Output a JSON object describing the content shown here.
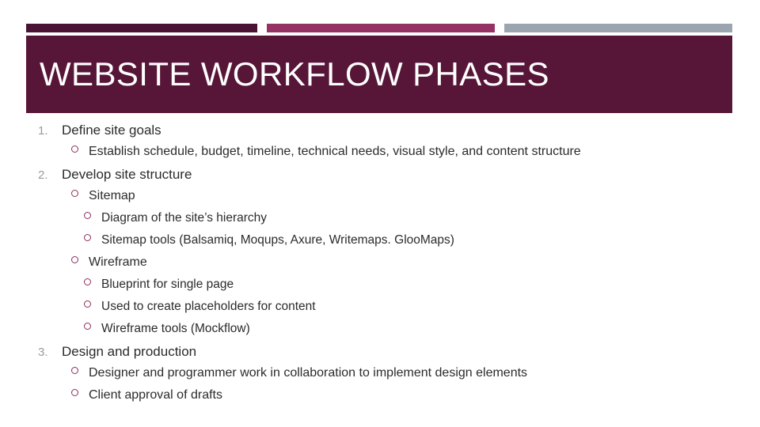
{
  "slide": {
    "title": "WEBSITE WORKFLOW PHASES",
    "accent_bars": [
      {
        "name": "bar-dark",
        "color": "#4A1333"
      },
      {
        "name": "bar-mid",
        "color": "#953263"
      },
      {
        "name": "bar-light",
        "color": "#9BA5AF"
      }
    ],
    "title_band_color": "#571638",
    "bullet_color": "#8C2D5B",
    "number_color": "#9A9A9A",
    "text_color": "#2B2B2B",
    "outline": [
      {
        "level": 1,
        "marker": "1.",
        "text": "Define site goals"
      },
      {
        "level": 2,
        "marker": "circle",
        "text": "Establish schedule, budget, timeline, technical needs, visual style, and content structure"
      },
      {
        "level": 1,
        "marker": "2.",
        "text": "Develop site structure"
      },
      {
        "level": 2,
        "marker": "circle",
        "text": "Sitemap"
      },
      {
        "level": 3,
        "marker": "circle",
        "text": "Diagram of the site’s hierarchy"
      },
      {
        "level": 3,
        "marker": "circle",
        "text": "Sitemap tools (Balsamiq, Moqups, Axure, Writemaps. GlooMaps)"
      },
      {
        "level": 2,
        "marker": "circle",
        "text": "Wireframe"
      },
      {
        "level": 3,
        "marker": "circle",
        "text": "Blueprint for single page"
      },
      {
        "level": 3,
        "marker": "circle",
        "text": "Used to create placeholders for content"
      },
      {
        "level": 3,
        "marker": "circle",
        "text": "Wireframe tools (Mockflow)"
      },
      {
        "level": 1,
        "marker": "3.",
        "text": "Design and production"
      },
      {
        "level": 2,
        "marker": "circle",
        "text": "Designer and programmer work in collaboration to implement design elements"
      },
      {
        "level": 2,
        "marker": "circle",
        "text": "Client approval of drafts"
      }
    ]
  }
}
